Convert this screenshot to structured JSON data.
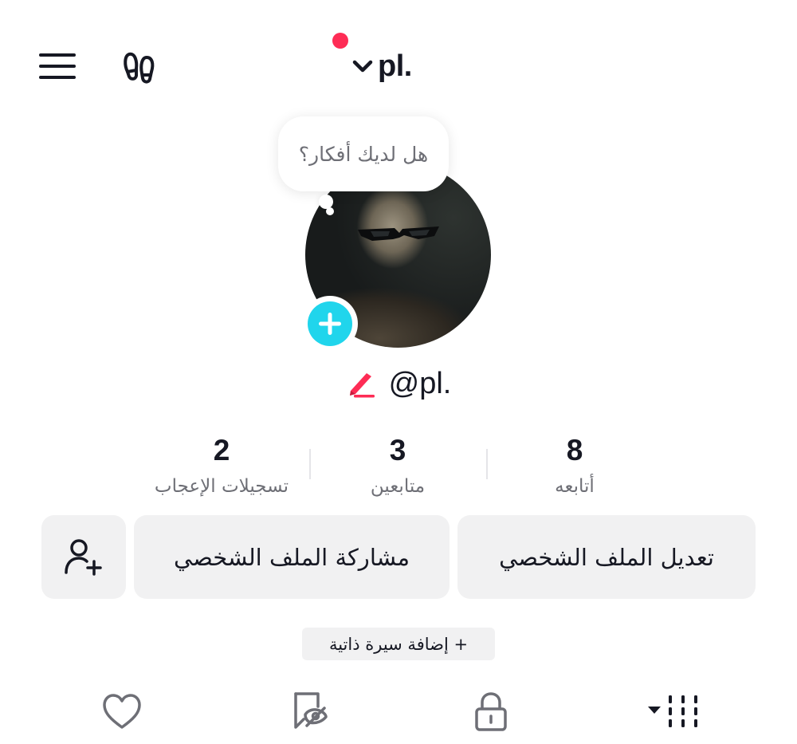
{
  "header": {
    "account_name": "pl.",
    "has_notification": true,
    "icons": [
      "menu-icon",
      "footprint-icon",
      "chevron-down-icon"
    ]
  },
  "profile": {
    "thought_bubble": "هل لديك أفكار؟",
    "username": "@pl.",
    "avatar_add_icon": "plus-icon"
  },
  "stats": {
    "following": {
      "value": "8",
      "label": "أتابعه"
    },
    "followers": {
      "value": "3",
      "label": "متابعين"
    },
    "likes": {
      "value": "2",
      "label": "تسجيلات الإعجاب"
    }
  },
  "actions": {
    "edit_profile": "تعديل الملف الشخصي",
    "share_profile": "مشاركة الملف الشخصي",
    "add_friend_icon": "add-user-icon"
  },
  "bio": {
    "add_bio": "+ إضافة سيرة ذاتية"
  },
  "tabs": [
    "videos-grid-icon",
    "lock-icon",
    "favorites-icon",
    "heart-icon"
  ],
  "colors": {
    "notification": "#fe2c55",
    "avatar_plus": "#20d5ec",
    "button_bg": "#f1f1f2",
    "edit_pen": "#fe2c55",
    "text_primary": "#161823",
    "text_secondary": "#6e6f76"
  }
}
